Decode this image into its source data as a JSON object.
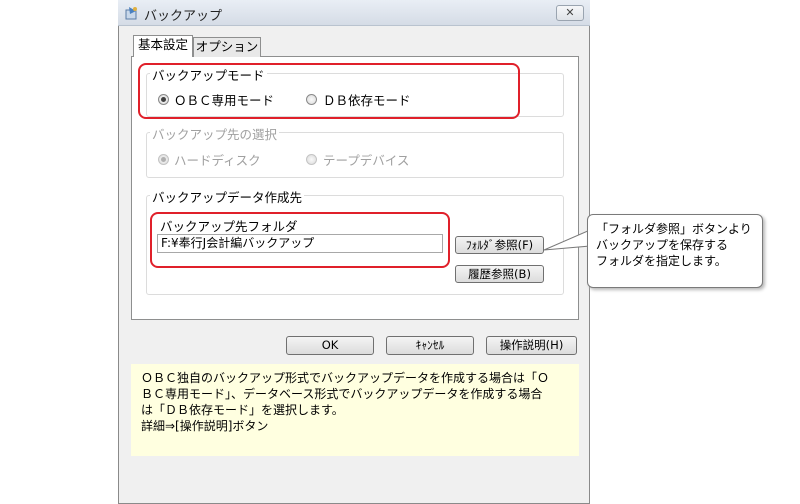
{
  "window": {
    "title": "バックアップ",
    "close_label": "✕"
  },
  "tabs": [
    {
      "label": "基本設定"
    },
    {
      "label": "オプション"
    }
  ],
  "backup_mode": {
    "legend": "バックアップモード",
    "options": [
      {
        "label": "ＯＢＣ専用モード",
        "selected": true
      },
      {
        "label": "ＤＢ依存モード",
        "selected": false
      }
    ]
  },
  "destination": {
    "legend": "バックアップ先の選択",
    "options": [
      {
        "label": "ハードディスク",
        "selected": true
      },
      {
        "label": "テープデバイス",
        "selected": false
      }
    ]
  },
  "creation": {
    "legend": "バックアップデータ作成先",
    "folder_label": "バックアップ先フォルダ",
    "folder_value": "F:¥奉行J会計編バックアップ",
    "folder_browse_label": "ﾌｫﾙﾀﾞ参照(F)",
    "history_browse_label": "履歴参照(B)"
  },
  "buttons": {
    "ok": "OK",
    "cancel": "ｷｬﾝｾﾙ",
    "help": "操作説明(H)"
  },
  "help_text": {
    "line1": "ＯＢＣ独自のバックアップ形式でバックアップデータを作成する場合は「Ｏ",
    "line2": "ＢＣ専用モード」、データベース形式でバックアップデータを作成する場合",
    "line3": "は「ＤＢ依存モード」を選択します。",
    "line4": "詳細⇒[操作説明]ボタン"
  },
  "callout": {
    "line1": "「フォルダ参照」ボタンより",
    "line2": "バックアップを保存する",
    "line3": "フォルダを指定します。"
  },
  "colors": {
    "highlight_border": "#e0202a",
    "help_background": "#ffffe0"
  }
}
